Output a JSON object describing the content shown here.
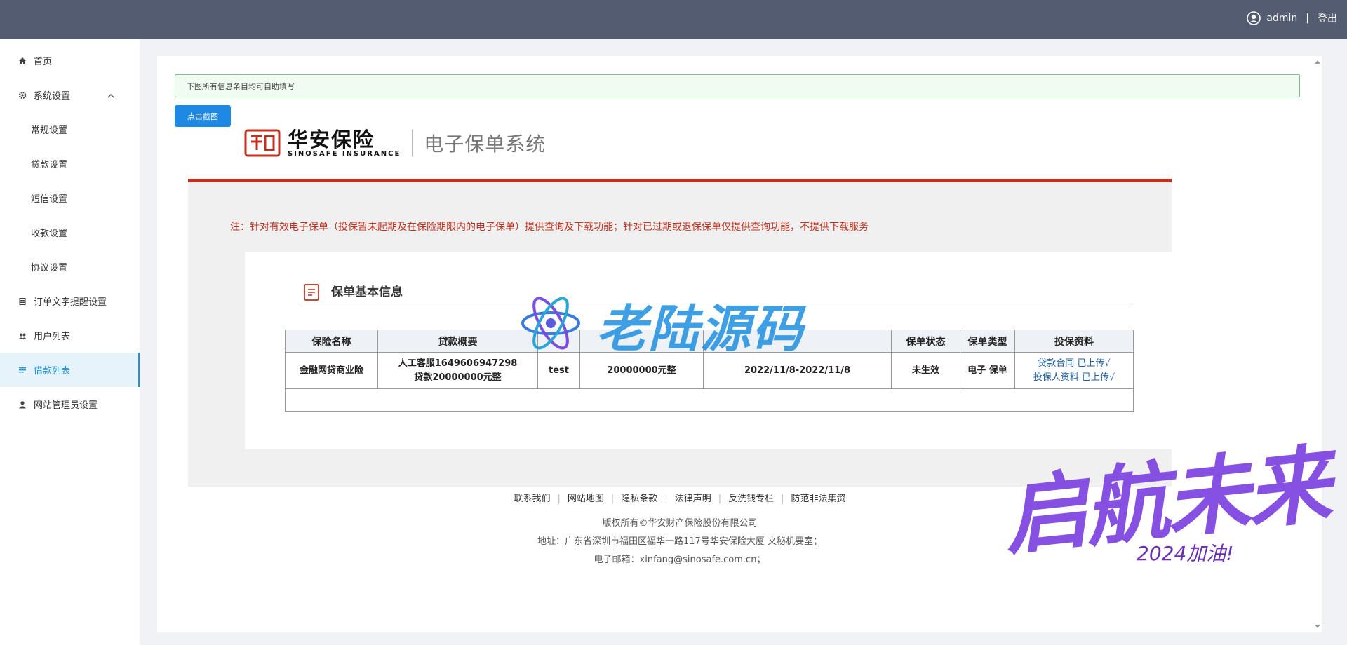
{
  "header": {
    "username": "admin",
    "separator": "|",
    "logout_label": "登出"
  },
  "sidebar": {
    "items": [
      {
        "label": "首页",
        "icon": "home-icon"
      },
      {
        "label": "系统设置",
        "icon": "gear-icon"
      },
      {
        "label": "常规设置"
      },
      {
        "label": "贷款设置"
      },
      {
        "label": "短信设置"
      },
      {
        "label": "收款设置"
      },
      {
        "label": "协议设置"
      },
      {
        "label": "订单文字提醒设置",
        "icon": "document-icon"
      },
      {
        "label": "用户列表",
        "icon": "users-icon"
      },
      {
        "label": "借款列表",
        "icon": "list-icon"
      },
      {
        "label": "网站管理员设置",
        "icon": "user-icon"
      }
    ]
  },
  "content": {
    "notice": "下图所有信息条目均可自助填写",
    "capture_button": "点击截图"
  },
  "policy": {
    "brand_cn": "华安保险",
    "brand_en": "SINOSAFE INSURANCE",
    "system_name": "电子保单系统",
    "note": "注：针对有效电子保单（投保暂未起期及在保险期限内的电子保单）提供查询及下载功能；针对已过期或退保保单仅提供查询功能，不提供下载服务",
    "section_title": "保单基本信息",
    "table": {
      "headers": [
        "保险名称",
        "贷款概要",
        "",
        "",
        "",
        "保单状态",
        "保单类型",
        "投保资料"
      ],
      "row": {
        "name": "金融网贷商业险",
        "summary_line1": "人工客服1649606947298",
        "summary_line2": "贷款20000000元整",
        "borrower": "test",
        "amount": "20000000元整",
        "period": "2022/11/8-2022/11/8",
        "status": "未生效",
        "type": "电子 保单",
        "file1": "贷款合同 已上传√",
        "file2": "投保人资料 已上传√"
      }
    }
  },
  "footer": {
    "links": [
      "联系我们",
      "网站地图",
      "隐私条款",
      "法律声明",
      "反洗钱专栏",
      "防范非法集资"
    ],
    "copyright": "版权所有©华安财产保险股份有限公司",
    "address": "地址：广东省深圳市福田区福华一路117号华安保险大厦 文秘机要室；",
    "email": "电子邮箱：xinfang@sinosafe.com.cn；"
  },
  "watermarks": {
    "center": "老陆源码",
    "corner": "启航未来",
    "corner_sub": "2024加油!"
  },
  "colors": {
    "header_bg": "#535c71",
    "accent": "#1e88e5",
    "brand_red": "#c0321f"
  }
}
